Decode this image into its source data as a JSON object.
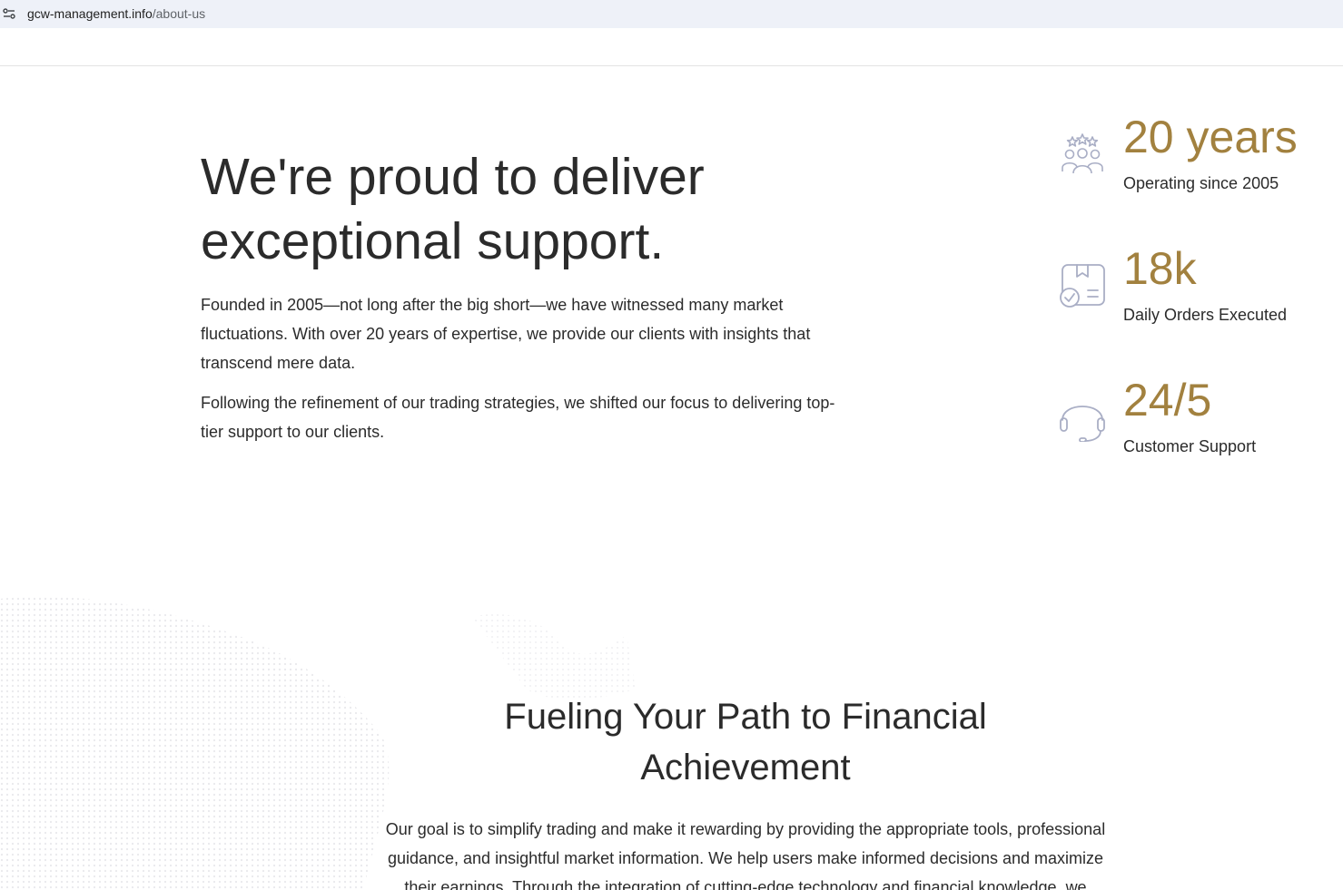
{
  "browser": {
    "url_domain": "gcw-management.info",
    "url_path": "/about-us"
  },
  "hero": {
    "title": "We're proud to deliver exceptional support.",
    "paragraph_1": "Founded in 2005—not long after the big short—we have witnessed many market fluctuations. With over 20 years of expertise, we provide our clients with insights that transcend mere data.",
    "paragraph_2": "Following the refinement of our trading strategies, we shifted our focus to delivering top-tier support to our clients."
  },
  "stats": [
    {
      "value": "20 years",
      "label": "Operating since 2005",
      "icon": "team-stars-icon"
    },
    {
      "value": "18k",
      "label": "Daily Orders Executed",
      "icon": "order-box-check-icon"
    },
    {
      "value": "24/5",
      "label": "Customer Support",
      "icon": "headset-icon"
    }
  ],
  "mission": {
    "title": "Fueling Your Path to Financial Achievement",
    "text": "Our goal is to simplify trading and make it rewarding by providing the appropriate tools, professional guidance, and insightful market information. We help users make informed decisions and maximize their earnings. Through the integration of cutting-edge technology and financial knowledge, we"
  },
  "colors": {
    "accent_gold": "#a2813f",
    "icon_gray_blue": "#a9aec5",
    "text": "#2b2b2b",
    "address_bar": "#eef1f8"
  }
}
